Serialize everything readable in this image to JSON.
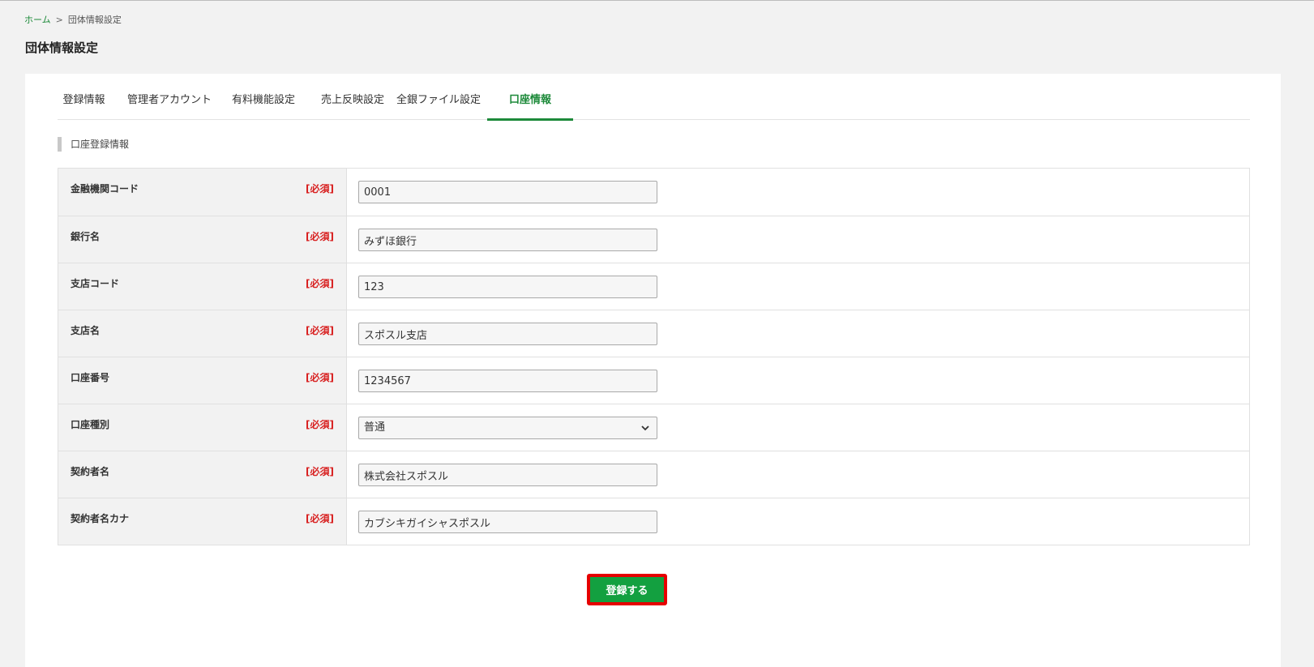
{
  "breadcrumb": {
    "home": "ホーム",
    "separator": ">",
    "current": "団体情報設定"
  },
  "page_title": "団体情報設定",
  "tabs": [
    {
      "label": "登録情報",
      "active": false
    },
    {
      "label": "管理者アカウント",
      "active": false
    },
    {
      "label": "有料機能設定",
      "active": false
    },
    {
      "label": "売上反映設定",
      "active": false
    },
    {
      "label": "全銀ファイル設定",
      "active": false
    },
    {
      "label": "口座情報",
      "active": true
    }
  ],
  "section_heading": "口座登録情報",
  "required_label": "[必須]",
  "fields": [
    {
      "label": "金融機関コード",
      "value": "0001",
      "type": "text"
    },
    {
      "label": "銀行名",
      "value": "みずほ銀行",
      "type": "text"
    },
    {
      "label": "支店コード",
      "value": "123",
      "type": "text"
    },
    {
      "label": "支店名",
      "value": "スポスル支店",
      "type": "text"
    },
    {
      "label": "口座番号",
      "value": "1234567",
      "type": "text"
    },
    {
      "label": "口座種別",
      "value": "普通",
      "type": "select"
    },
    {
      "label": "契約者名",
      "value": "株式会社スポスル",
      "type": "text"
    },
    {
      "label": "契約者名カナ",
      "value": "カブシキガイシャスポスル",
      "type": "text"
    }
  ],
  "submit_label": "登録する",
  "colors": {
    "accent": "#1d8a3a",
    "button": "#13a040",
    "required": "#d82020",
    "highlight": "#e60000"
  },
  "icons": {
    "select_arrow": "chevron-down-icon"
  }
}
